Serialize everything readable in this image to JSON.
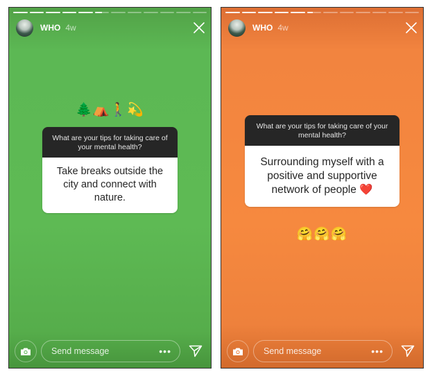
{
  "stories": [
    {
      "theme": "green",
      "background_color": "#5cb854",
      "progress": {
        "segments": 12,
        "completed": 5,
        "current_fraction": 0.5
      },
      "username": "WHO",
      "age": "4w",
      "emojis": "🌲⛺🚶💫",
      "question": "What are your tips for taking care of your mental health?",
      "answer": "Take breaks outside the city and connect with nature.",
      "message_placeholder": "Send message",
      "more_label": "•••"
    },
    {
      "theme": "orange",
      "background_color": "#f6893f",
      "progress": {
        "segments": 12,
        "completed": 5,
        "current_fraction": 0.4
      },
      "username": "WHO",
      "age": "4w",
      "emojis": "🤗🤗🤗",
      "question": "What are your tips for taking care of your mental health?",
      "answer": "Surrounding myself with a positive and supportive network of people ❤️",
      "message_placeholder": "Send message",
      "more_label": "•••"
    }
  ]
}
